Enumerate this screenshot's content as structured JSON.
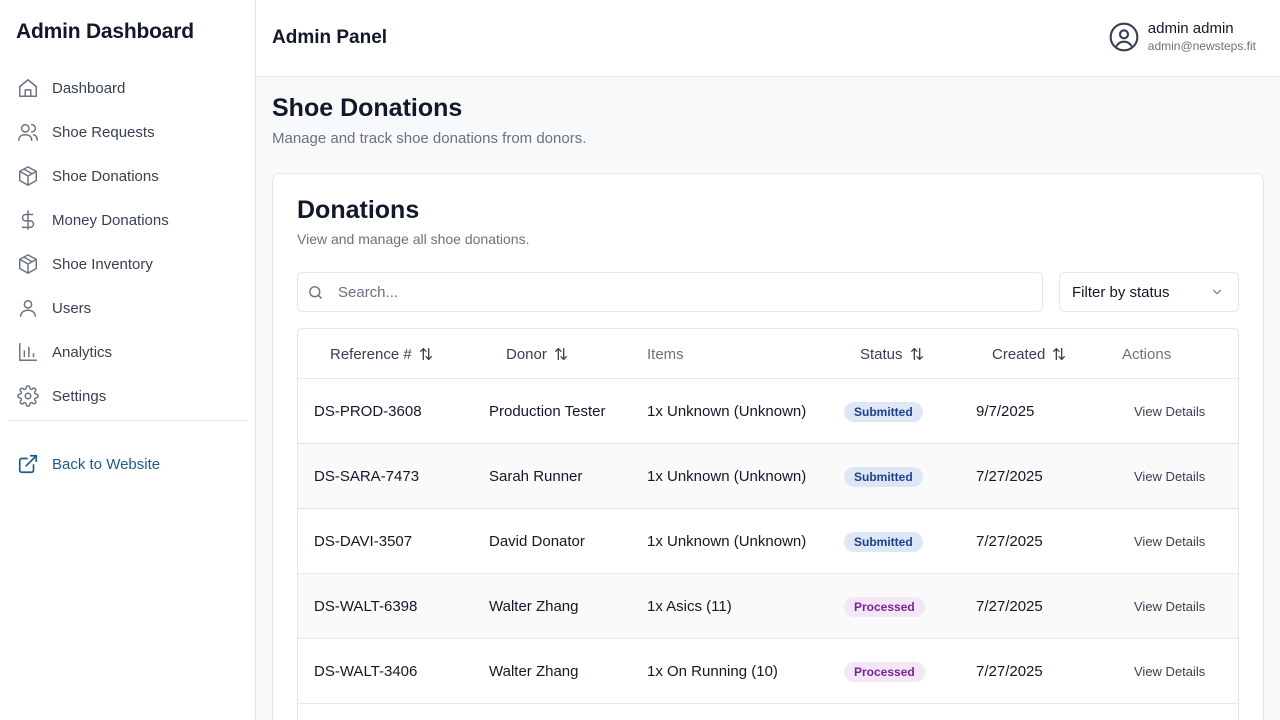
{
  "sidebar": {
    "brand": "Admin Dashboard",
    "items": [
      {
        "label": "Dashboard",
        "icon": "home-icon"
      },
      {
        "label": "Shoe Requests",
        "icon": "users-icon"
      },
      {
        "label": "Shoe Donations",
        "icon": "package-icon"
      },
      {
        "label": "Money Donations",
        "icon": "dollar-icon"
      },
      {
        "label": "Shoe Inventory",
        "icon": "package-icon"
      },
      {
        "label": "Users",
        "icon": "user-icon"
      },
      {
        "label": "Analytics",
        "icon": "bar-chart-icon"
      },
      {
        "label": "Settings",
        "icon": "gear-icon"
      }
    ],
    "back_link": "Back to Website"
  },
  "header": {
    "title": "Admin Panel",
    "user_name": "admin admin",
    "user_email": "admin@newsteps.fit"
  },
  "main": {
    "title": "Shoe Donations",
    "subtitle": "Manage and track shoe donations from donors.",
    "card": {
      "title": "Donations",
      "subtitle": "View and manage all shoe donations.",
      "search_placeholder": "Search...",
      "filter_label": "Filter by status"
    },
    "table": {
      "columns": [
        "Reference #",
        "Donor",
        "Items",
        "Status",
        "Created",
        "Actions"
      ],
      "rows": [
        {
          "ref": "DS-PROD-3608",
          "donor": "Production Tester",
          "items": "1x Unknown (Unknown)",
          "status": "Submitted",
          "created": "9/7/2025",
          "action": "View Details"
        },
        {
          "ref": "DS-SARA-7473",
          "donor": "Sarah Runner",
          "items": "1x Unknown (Unknown)",
          "status": "Submitted",
          "created": "7/27/2025",
          "action": "View Details"
        },
        {
          "ref": "DS-DAVI-3507",
          "donor": "David Donator",
          "items": "1x Unknown (Unknown)",
          "status": "Submitted",
          "created": "7/27/2025",
          "action": "View Details"
        },
        {
          "ref": "DS-WALT-6398",
          "donor": "Walter Zhang",
          "items": "1x Asics (11)",
          "status": "Processed",
          "created": "7/27/2025",
          "action": "View Details"
        },
        {
          "ref": "DS-WALT-3406",
          "donor": "Walter Zhang",
          "items": "1x On Running (10)",
          "status": "Processed",
          "created": "7/27/2025",
          "action": "View Details"
        }
      ]
    }
  },
  "colors": {
    "accent": "#1d5a8c",
    "submitted_bg": "#dde7f6",
    "submitted_text": "#1f3f8a",
    "processed_bg": "#f3e6f7",
    "processed_text": "#7a2393"
  }
}
